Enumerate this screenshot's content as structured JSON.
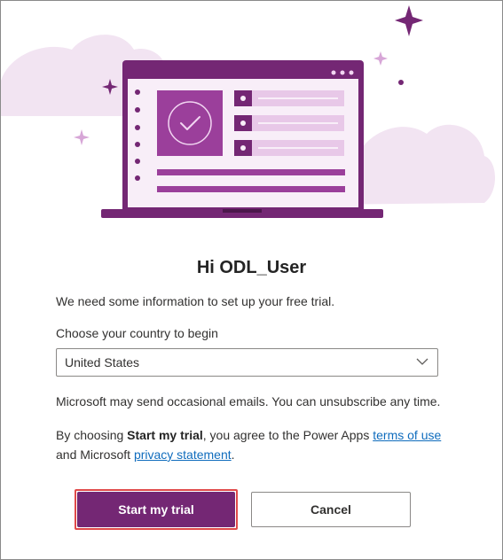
{
  "colors": {
    "brand": "#742774",
    "link": "#0f6cbd",
    "highlight_border": "#e04a4a"
  },
  "hero": {
    "illustration": "laptop-with-checkmark-illustration"
  },
  "heading": "Hi ODL_User",
  "intro": "We need some information to set up your free trial.",
  "country": {
    "label": "Choose your country to begin",
    "selected": "United States"
  },
  "emails_notice": "Microsoft may send occasional emails. You can unsubscribe any time.",
  "terms": {
    "prefix": "By choosing ",
    "bold": "Start my trial",
    "middle": ", you agree to the Power Apps ",
    "terms_link": "terms of use",
    "and": " and Microsoft ",
    "privacy_link": "privacy statement",
    "suffix": "."
  },
  "buttons": {
    "start": "Start my trial",
    "cancel": "Cancel"
  }
}
